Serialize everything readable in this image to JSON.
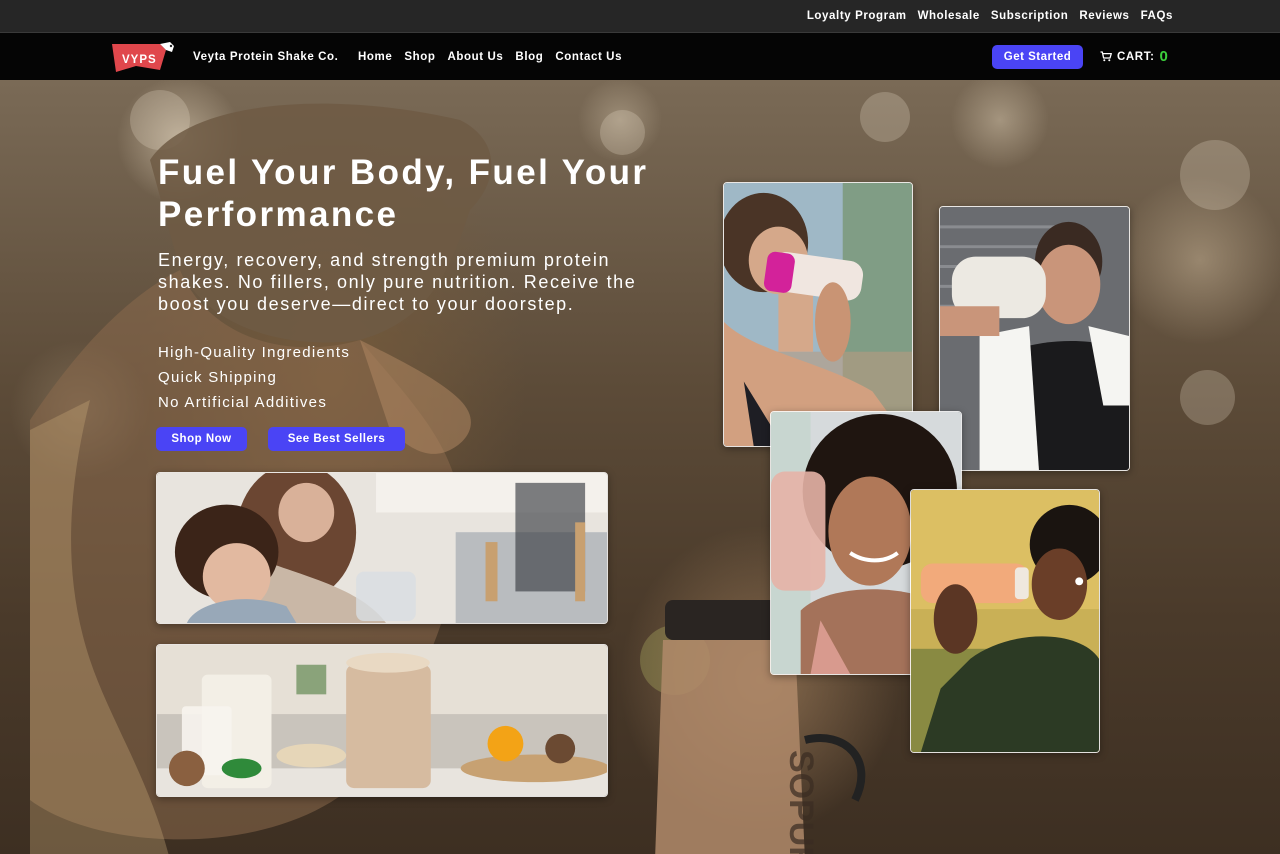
{
  "utility_nav": {
    "links": [
      "Loyalty Program",
      "Wholesale",
      "Subscription",
      "Reviews",
      "FAQs"
    ]
  },
  "main_nav": {
    "logo_text": "VYPS",
    "brand_name": "Veyta Protein Shake Co.",
    "links": [
      "Home",
      "Shop",
      "About Us",
      "Blog",
      "Contact Us"
    ],
    "get_started_label": "Get Started",
    "cart_label": "CART:",
    "cart_count": "0"
  },
  "hero": {
    "title": "Fuel Your Body, Fuel Your Performance",
    "subtitle": "Energy, recovery, and strength premium protein shakes. No fillers, only pure nutrition. Receive the boost you deserve—direct to your doorstep.",
    "features": [
      "High-Quality Ingredients",
      "Quick Shipping",
      "No Artificial Additives"
    ],
    "primary_cta": "Shop Now",
    "secondary_cta": "See Best Sellers"
  },
  "colors": {
    "accent": "#4a44f5",
    "cart_count": "#3ccf3c",
    "logo_red": "#e0474c",
    "utility_bar": "#262626",
    "nav_bar": "#050505"
  },
  "icons": {
    "cart": "cart-icon",
    "logo": "cow-logo-icon"
  }
}
